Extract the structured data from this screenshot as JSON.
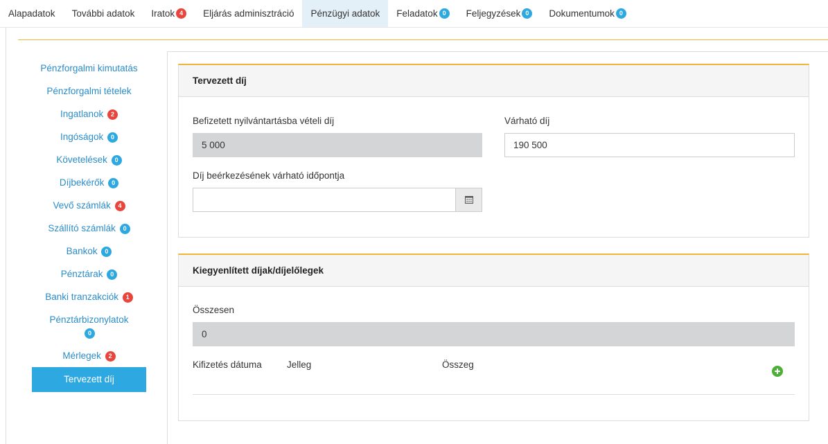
{
  "tabs": [
    {
      "label": "Alapadatok",
      "badge": null,
      "badge_color": null,
      "active": false
    },
    {
      "label": "További adatok",
      "badge": null,
      "badge_color": null,
      "active": false
    },
    {
      "label": "Iratok",
      "badge": "4",
      "badge_color": "red",
      "active": false
    },
    {
      "label": "Eljárás adminisztráció",
      "badge": null,
      "badge_color": null,
      "active": false
    },
    {
      "label": "Pénzügyi adatok",
      "badge": null,
      "badge_color": null,
      "active": true
    },
    {
      "label": "Feladatok",
      "badge": "0",
      "badge_color": "blue",
      "active": false
    },
    {
      "label": "Feljegyzések",
      "badge": "0",
      "badge_color": "blue",
      "active": false
    },
    {
      "label": "Dokumentumok",
      "badge": "0",
      "badge_color": "blue",
      "active": false
    }
  ],
  "sidenav": {
    "items": [
      {
        "label": "Pénzforgalmi kimutatás",
        "badge": null
      },
      {
        "label": "Pénzforgalmi tételek",
        "badge": null
      },
      {
        "label": "Ingatlanok",
        "badge": "2",
        "badge_color": "red"
      },
      {
        "label": "Ingóságok",
        "badge": "0",
        "badge_color": "blue"
      },
      {
        "label": "Követelések",
        "badge": "0",
        "badge_color": "blue"
      },
      {
        "label": "Díjbekérők",
        "badge": "0",
        "badge_color": "blue"
      },
      {
        "label": "Vevő számlák",
        "badge": "4",
        "badge_color": "red"
      },
      {
        "label": "Szállító számlák",
        "badge": "0",
        "badge_color": "blue"
      },
      {
        "label": "Bankok",
        "badge": "0",
        "badge_color": "blue"
      },
      {
        "label": "Pénztárak",
        "badge": "0",
        "badge_color": "blue"
      },
      {
        "label": "Banki tranzakciók",
        "badge": "1",
        "badge_color": "red"
      },
      {
        "label": "Pénztárbizonylatok",
        "badge": "0",
        "badge_color": "blue"
      },
      {
        "label": "Mérlegek",
        "badge": "2",
        "badge_color": "red"
      },
      {
        "label": "Tervezett díj",
        "badge": null,
        "active": true
      }
    ]
  },
  "planned_fee": {
    "title": "Tervezett díj",
    "paid_fee_label": "Befizetett nyilvántartásba vételi díj",
    "paid_fee_value": "5 000",
    "expected_fee_label": "Várható díj",
    "expected_fee_value": "190 500",
    "expected_date_label": "Díj beérkezésének várható időpontja",
    "expected_date_value": ""
  },
  "settled": {
    "title": "Kiegyenlített díjak/díjelőlegek",
    "total_label": "Összesen",
    "total_value": "0",
    "columns": [
      "Kifizetés dátuma",
      "Jelleg",
      "Összeg"
    ]
  },
  "colors": {
    "accent": "#2ea8e0",
    "panel_border": "#f0b536",
    "badge_red": "#e8453c",
    "add_green": "#4caf3a",
    "readonly_bg": "#d4d5d6"
  },
  "icons": {
    "calendar": "calendar-icon",
    "add": "plus-circle-icon"
  }
}
